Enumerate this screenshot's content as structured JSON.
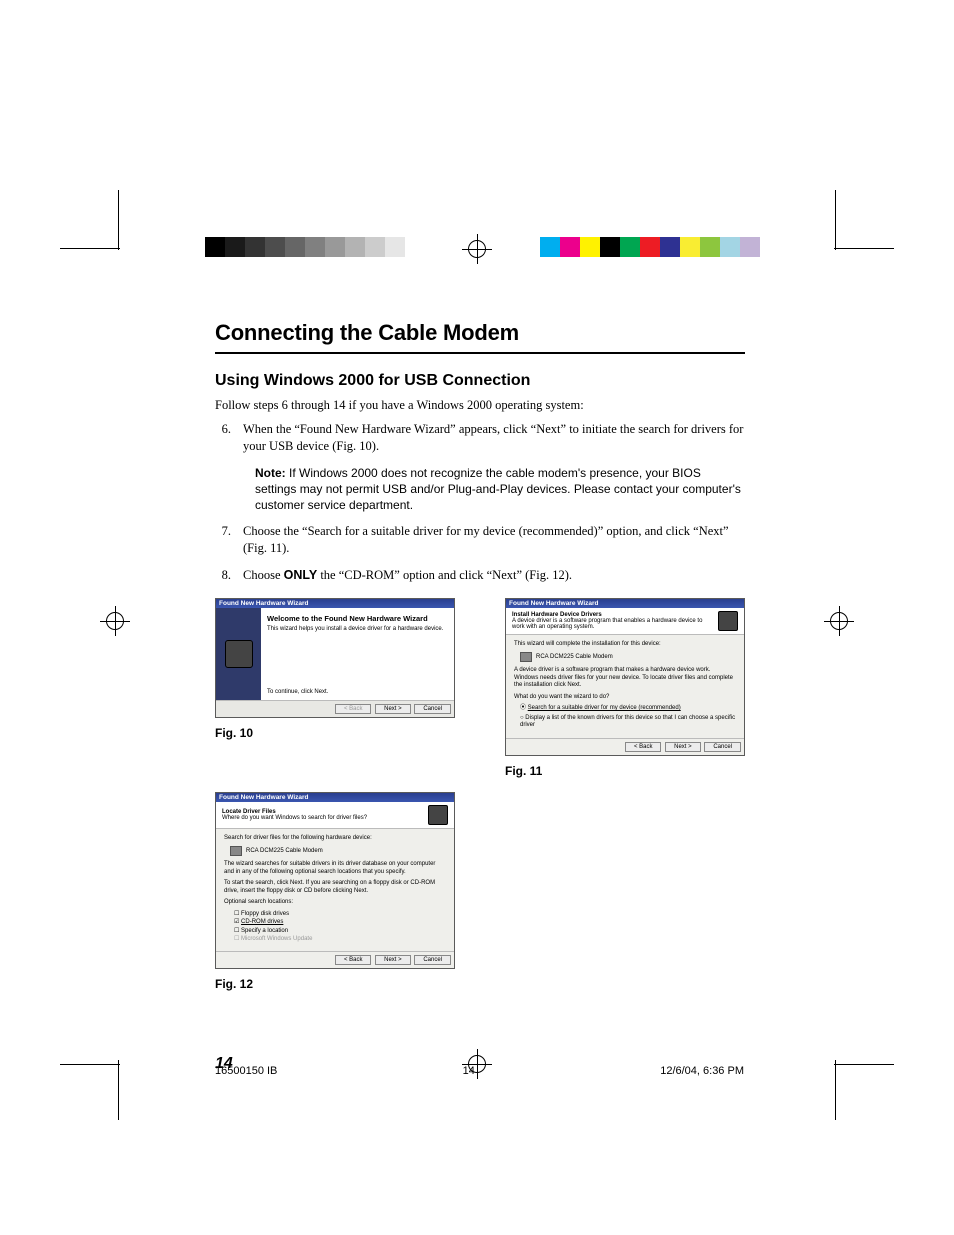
{
  "heading": "Connecting the Cable Modem",
  "subheading": "Using Windows 2000 for USB Connection",
  "intro": "Follow steps 6 through 14 if you have a Windows 2000 operating system:",
  "steps": {
    "s6_num": "6.",
    "s6": "When the “Found New Hardware Wizard” appears, click “Next” to initiate the search for drivers for your USB device (Fig. 10).",
    "note_label": "Note:",
    "note_body": " If Windows 2000 does not recognize the cable modem's presence, your BIOS settings may not permit USB and/or Plug-and-Play devices. Please contact your computer's customer service department.",
    "s7_num": "7.",
    "s7": "Choose the “Search for a suitable driver for my device (recommended)” option, and click “Next” (Fig. 11).",
    "s8_num": "8.",
    "s8_a": "Choose ",
    "s8_bold": "ONLY",
    "s8_b": " the “CD-ROM” option and click “Next” (Fig. 12)."
  },
  "fig10": {
    "titlebar": "Found New Hardware Wizard",
    "h": "Welcome to the Found New Hardware Wizard",
    "p1": "This wizard helps you install a device driver for a hardware device.",
    "p2": "To continue, click Next.",
    "back": "< Back",
    "next": "Next >",
    "cancel": "Cancel",
    "caption": "Fig. 10"
  },
  "fig11": {
    "titlebar": "Found New Hardware Wizard",
    "h": "Install Hardware Device Drivers",
    "sub": "A device driver is a software program that enables a hardware device to work with an operating system.",
    "p1": "This wizard will complete the installation for this device:",
    "dev": "RCA DCM225 Cable Modem",
    "p2": "A device driver is a software program that makes a hardware device work. Windows needs driver files for your new device. To locate driver files and complete the installation click Next.",
    "q": "What do you want the wizard to do?",
    "r1": "Search for a suitable driver for my device (recommended)",
    "r2": "Display a list of the known drivers for this device so that I can choose a specific driver",
    "back": "< Back",
    "next": "Next >",
    "cancel": "Cancel",
    "caption": "Fig. 11"
  },
  "fig12": {
    "titlebar": "Found New Hardware Wizard",
    "h": "Locate Driver Files",
    "sub": "Where do you want Windows to search for driver files?",
    "p1": "Search for driver files for the following hardware device:",
    "dev": "RCA DCM225 Cable Modem",
    "p2": "The wizard searches for suitable drivers in its driver database on your computer and in any of the following optional search locations that you specify.",
    "p3": "To start the search, click Next. If you are searching on a floppy disk or CD-ROM drive, insert the floppy disk or CD before clicking Next.",
    "loc": "Optional search locations:",
    "c1": "Floppy disk drives",
    "c2": "CD-ROM drives",
    "c3": "Specify a location",
    "c4": "Microsoft Windows Update",
    "back": "< Back",
    "next": "Next >",
    "cancel": "Cancel",
    "caption": "Fig. 12"
  },
  "page_number": "14",
  "footer": {
    "left": "16500150 IB",
    "center": "14",
    "right": "12/6/04, 6:36 PM"
  },
  "colorbars": {
    "left": [
      "#000000",
      "#1a1a1a",
      "#333333",
      "#4d4d4d",
      "#666666",
      "#808080",
      "#999999",
      "#b3b3b3",
      "#cccccc",
      "#e6e6e6",
      "#ffffff"
    ],
    "right": [
      "#00aeef",
      "#ec008c",
      "#fff200",
      "#000000",
      "#00a651",
      "#ed1c24",
      "#2e3192",
      "#f9ed32",
      "#8dc63e",
      "#a3d5e4",
      "#c2b3d6"
    ]
  }
}
